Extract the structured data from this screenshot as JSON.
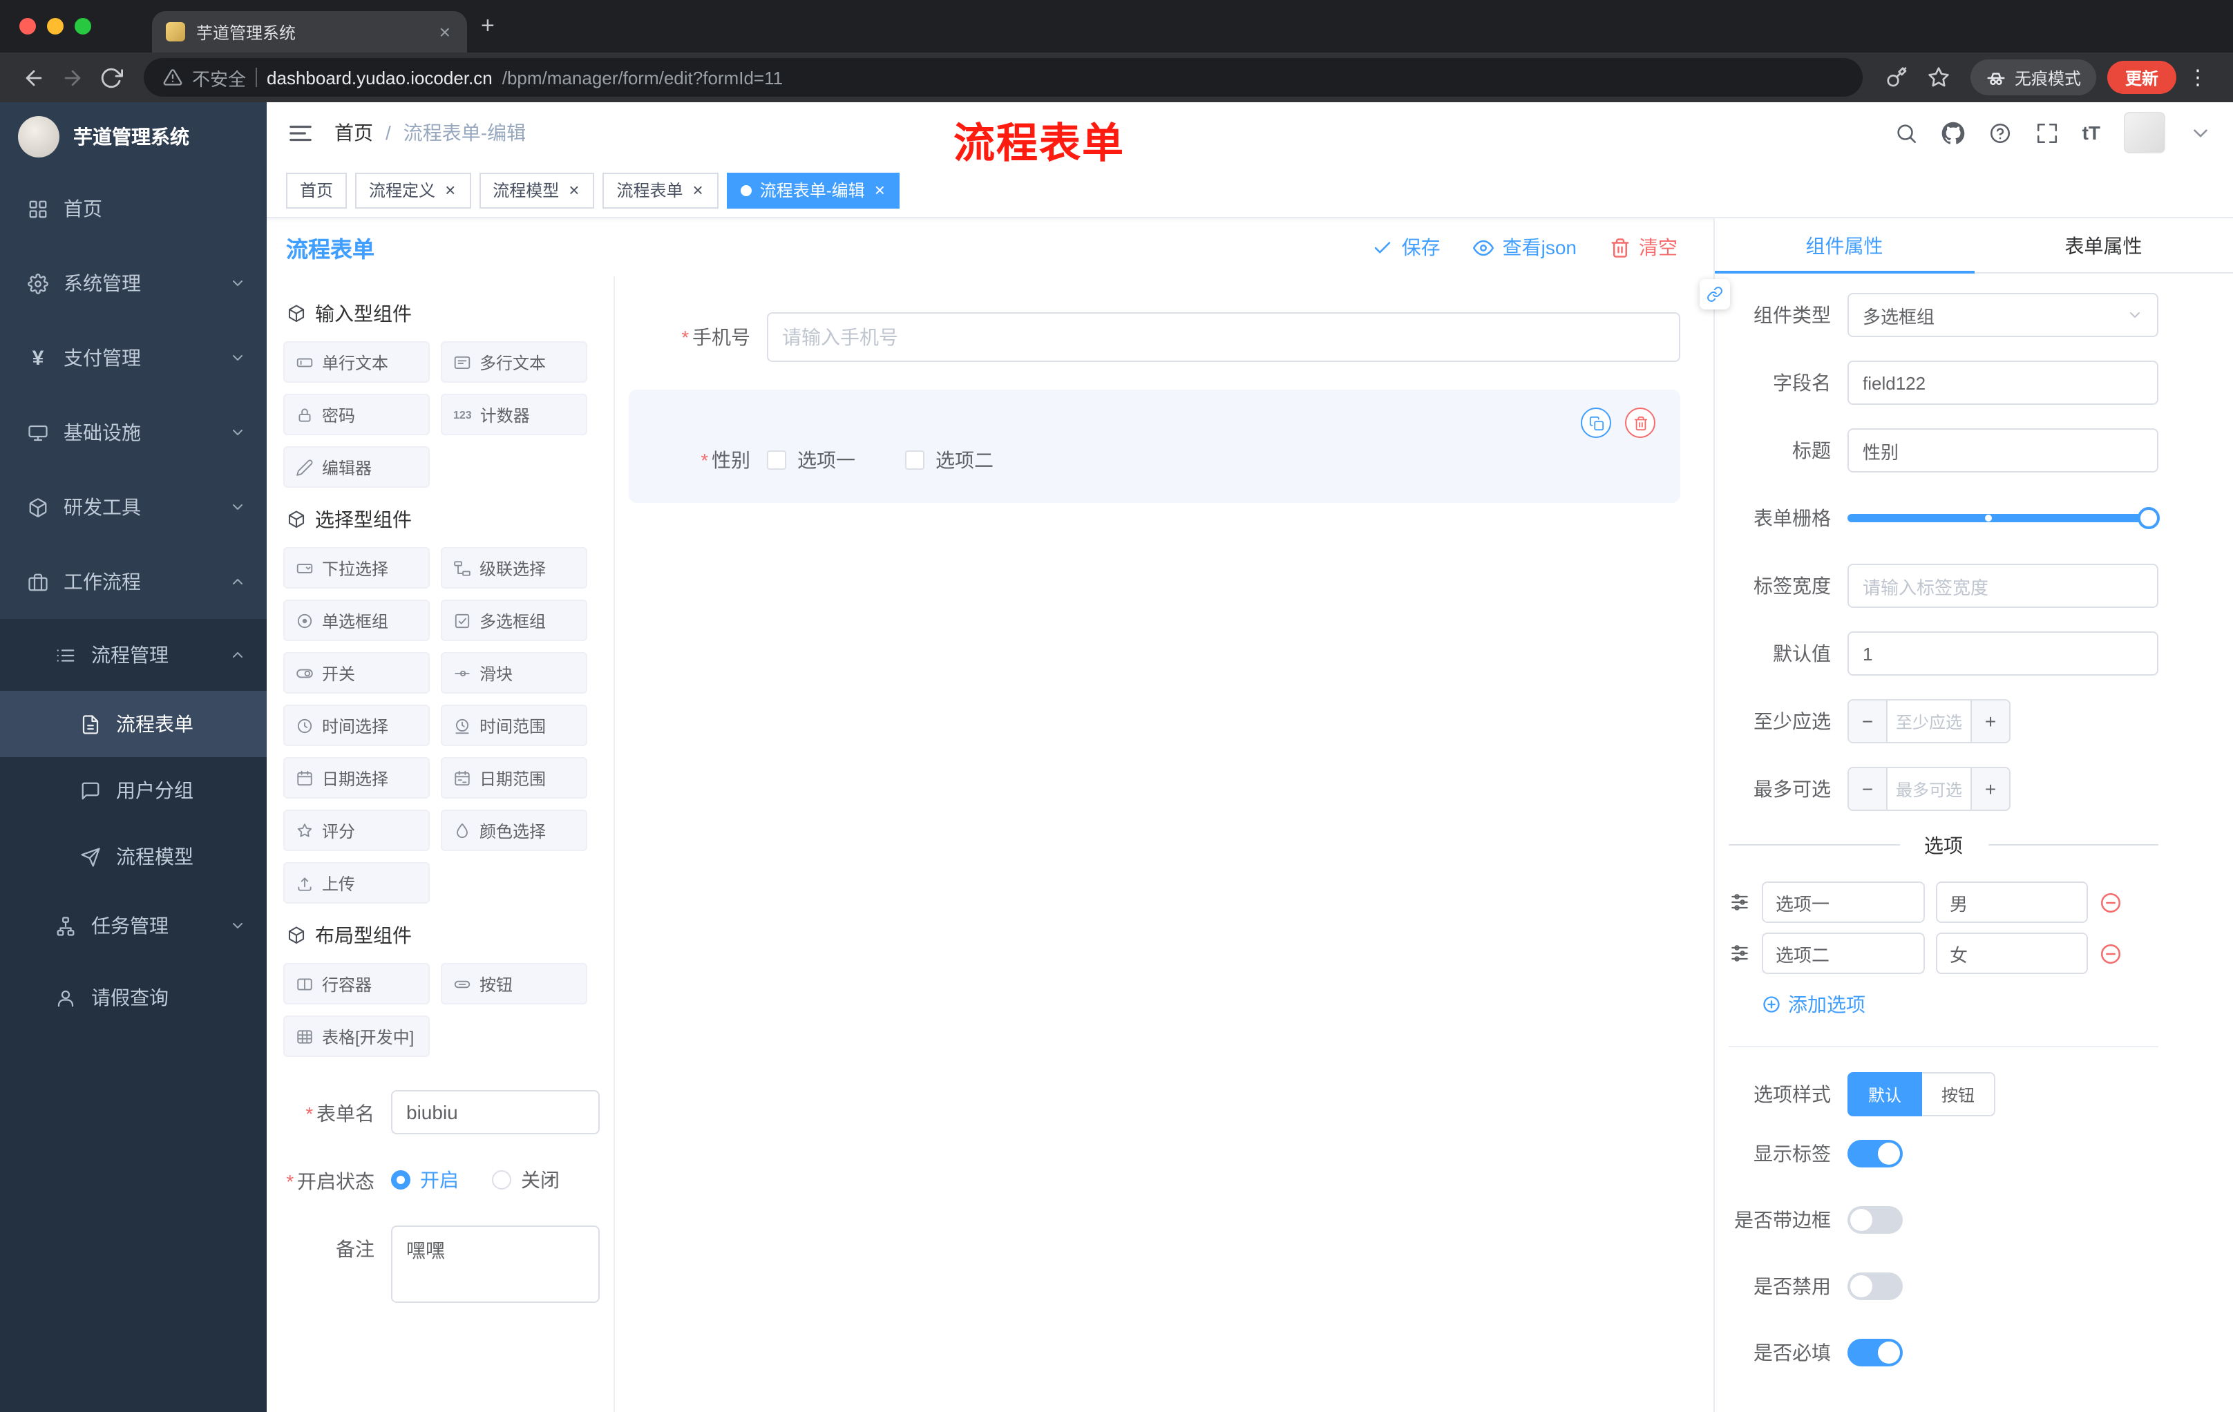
{
  "colors": {
    "primary": "#409eff",
    "danger": "#f56c6c",
    "annotation_red": "#fe1b10",
    "update_button": "#e9483a",
    "sidebar": "#2f3d51"
  },
  "glyphs": {
    "close": "×",
    "yen": "¥",
    "counter": "123",
    "plus": "+",
    "minus": "−",
    "dots": "⋮",
    "required": "*",
    "slash": "/",
    "font_size": "tT"
  },
  "browser": {
    "tab": {
      "title": "芋道管理系统"
    },
    "address": {
      "security_label": "不安全",
      "url_host": "dashboard.yudao.iocoder.cn",
      "url_path": "/bpm/manager/form/edit?formId=11"
    },
    "incognito_label": "无痕模式",
    "update_button": "更新"
  },
  "sidebar": {
    "logo_title": "芋道管理系统",
    "items": [
      {
        "label": "首页",
        "icon": "dashboard-icon",
        "level": 1
      },
      {
        "label": "系统管理",
        "icon": "gear-icon",
        "level": 1,
        "chevron": "down"
      },
      {
        "label": "支付管理",
        "icon": "yen-icon",
        "level": 1,
        "chevron": "down"
      },
      {
        "label": "基础设施",
        "icon": "monitor-icon",
        "level": 1,
        "chevron": "down"
      },
      {
        "label": "研发工具",
        "icon": "box-icon",
        "level": 1,
        "chevron": "down"
      },
      {
        "label": "工作流程",
        "icon": "briefcase-icon",
        "level": 1,
        "chevron": "up"
      },
      {
        "label": "流程管理",
        "icon": "list-icon",
        "level": 2,
        "chevron": "up"
      },
      {
        "label": "流程表单",
        "icon": "document-icon",
        "level": 3,
        "active": true
      },
      {
        "label": "用户分组",
        "icon": "chat-icon",
        "level": 3
      },
      {
        "label": "流程模型",
        "icon": "send-icon",
        "level": 3
      },
      {
        "label": "任务管理",
        "icon": "tree-icon",
        "level": 2,
        "chevron": "down"
      },
      {
        "label": "请假查询",
        "icon": "user-icon",
        "level": 2
      }
    ]
  },
  "header": {
    "breadcrumb": [
      "首页",
      "流程表单-编辑"
    ],
    "annotation": "流程表单"
  },
  "tags": [
    {
      "label": "首页",
      "closable": false,
      "active": false
    },
    {
      "label": "流程定义",
      "closable": true,
      "active": false
    },
    {
      "label": "流程模型",
      "closable": true,
      "active": false
    },
    {
      "label": "流程表单",
      "closable": true,
      "active": false
    },
    {
      "label": "流程表单-编辑",
      "closable": true,
      "active": true
    }
  ],
  "designer": {
    "title": "流程表单",
    "actions": {
      "save": "保存",
      "view_json": "查看json",
      "clear": "清空"
    },
    "groups": [
      {
        "title": "输入型组件",
        "items": [
          {
            "label": "单行文本",
            "icon": "input"
          },
          {
            "label": "多行文本",
            "icon": "textarea"
          },
          {
            "label": "密码",
            "icon": "lock"
          },
          {
            "label": "计数器",
            "icon": "counter"
          },
          {
            "label": "编辑器",
            "icon": "editor"
          }
        ]
      },
      {
        "title": "选择型组件",
        "items": [
          {
            "label": "下拉选择",
            "icon": "select"
          },
          {
            "label": "级联选择",
            "icon": "cascade"
          },
          {
            "label": "单选框组",
            "icon": "radio"
          },
          {
            "label": "多选框组",
            "icon": "checkbox"
          },
          {
            "label": "开关",
            "icon": "switch"
          },
          {
            "label": "滑块",
            "icon": "slider"
          },
          {
            "label": "时间选择",
            "icon": "time"
          },
          {
            "label": "时间范围",
            "icon": "time-range"
          },
          {
            "label": "日期选择",
            "icon": "date"
          },
          {
            "label": "日期范围",
            "icon": "date-range"
          },
          {
            "label": "评分",
            "icon": "star"
          },
          {
            "label": "颜色选择",
            "icon": "color"
          },
          {
            "label": "上传",
            "icon": "upload"
          }
        ]
      },
      {
        "title": "布局型组件",
        "items": [
          {
            "label": "行容器",
            "icon": "row"
          },
          {
            "label": "按钮",
            "icon": "button"
          },
          {
            "label": "表格[开发中]",
            "icon": "table"
          }
        ]
      }
    ],
    "meta": {
      "name_label": "表单名",
      "name_value": "biubiu",
      "status_label": "开启状态",
      "status_on": "开启",
      "status_off": "关闭",
      "status_selected": "开启",
      "remark_label": "备注",
      "remark_value": "嘿嘿"
    },
    "canvas": {
      "fields": [
        {
          "label": "手机号",
          "required": true,
          "type": "input",
          "placeholder": "请输入手机号"
        },
        {
          "label": "性别",
          "required": true,
          "type": "checkbox-group",
          "options": [
            "选项一",
            "选项二"
          ],
          "selected": true
        }
      ]
    }
  },
  "properties": {
    "tabs": [
      {
        "label": "组件属性",
        "active": true
      },
      {
        "label": "表单属性",
        "active": false
      }
    ],
    "rows": {
      "component_type": {
        "label": "组件类型",
        "value": "多选框组"
      },
      "field_name": {
        "label": "字段名",
        "value": "field122"
      },
      "title": {
        "label": "标题",
        "value": "性别"
      },
      "grid": {
        "label": "表单栅格"
      },
      "label_width": {
        "label": "标签宽度",
        "placeholder": "请输入标签宽度"
      },
      "default_value": {
        "label": "默认值",
        "value": "1"
      },
      "min_select": {
        "label": "至少应选",
        "placeholder": "至少应选"
      },
      "max_select": {
        "label": "最多可选",
        "placeholder": "最多可选"
      }
    },
    "options_section": {
      "title": "选项",
      "options": [
        {
          "label": "选项一",
          "value": "男"
        },
        {
          "label": "选项二",
          "value": "女"
        }
      ],
      "add_label": "添加选项"
    },
    "style_row": {
      "label": "选项样式",
      "choices": [
        "默认",
        "按钮"
      ],
      "selected": "默认"
    },
    "toggles": [
      {
        "label": "显示标签",
        "on": true
      },
      {
        "label": "是否带边框",
        "on": false
      },
      {
        "label": "是否禁用",
        "on": false
      },
      {
        "label": "是否必填",
        "on": true
      }
    ]
  }
}
